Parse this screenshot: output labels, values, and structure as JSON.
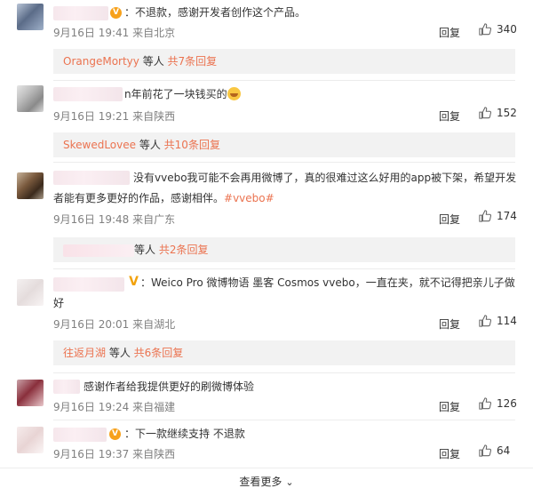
{
  "comments": [
    {
      "text": "：不退款，感谢开发者创作这个产品。",
      "date": "9月16日 19:41",
      "location": "来自北京",
      "reply": "回复",
      "likes": "340",
      "sub": {
        "user": "OrangeMortyy",
        "mid": " 等人 ",
        "count": "共7条回复"
      }
    },
    {
      "text": "n年前花了一块钱买的",
      "date": "9月16日 19:21",
      "location": "来自陕西",
      "reply": "回复",
      "likes": "152",
      "sub": {
        "user": "SkewedLovee",
        "mid": " 等人 ",
        "count": "共10条回复"
      }
    },
    {
      "text_line1": "没有vvebo我可能不会再用微博了，真的很难过这么好用的app被下架，希望开发",
      "text_line2_pre": "者能有更多更好的作品，感谢相伴。",
      "hashtag": "#vvebo#",
      "date": "9月16日 19:48",
      "location": "来自广东",
      "reply": "回复",
      "likes": "174",
      "sub": {
        "mid": "等人 ",
        "count": "共2条回复"
      }
    },
    {
      "text_line1": "：Weico Pro 微博物语 墨客 Cosmos vvebo，一直在夹，就不记得把亲儿子做",
      "text_line2": "好",
      "date": "9月16日 20:01",
      "location": "来自湖北",
      "reply": "回复",
      "likes": "114",
      "sub": {
        "user": "往返月湖",
        "mid": " 等人 ",
        "count": "共6条回复"
      }
    },
    {
      "text": "感谢作者给我提供更好的刷微博体验",
      "date": "9月16日 19:24",
      "location": "来自福建",
      "reply": "回复",
      "likes": "126"
    },
    {
      "text": "：下一款继续支持 不退款",
      "date": "9月16日 19:37",
      "location": "来自陕西",
      "reply": "回复",
      "likes": "64"
    }
  ],
  "more_label": "查看更多",
  "colors": {
    "accent": "#eb7350",
    "meta": "#808080",
    "subbox": "#f2f2f2"
  },
  "icons": {
    "like": "thumbs-up-icon",
    "more": "chevron-down-icon",
    "verified": "verified-badge-icon"
  }
}
